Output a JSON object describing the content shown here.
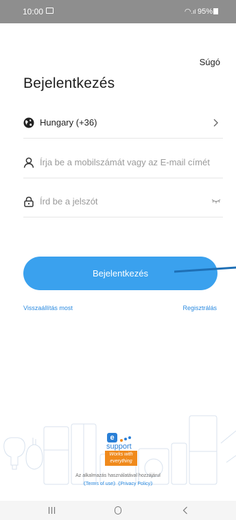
{
  "status_bar": {
    "time": "10:00",
    "battery": "95%",
    "icons": [
      "image-icon",
      "wifi-icon",
      "signal-icon",
      "battery-icon"
    ]
  },
  "header": {
    "help_label": "Súgó"
  },
  "page": {
    "title": "Bejelentkezés"
  },
  "form": {
    "country": {
      "value": "Hungary (+36)",
      "icon": "globe-icon"
    },
    "account": {
      "placeholder": "Írja be a mobilszámát vagy az E-mail címét",
      "icon": "user-icon"
    },
    "password": {
      "placeholder": "Írd be a jelszót",
      "icon": "lock-icon"
    }
  },
  "actions": {
    "login_label": "Bejelentkezés",
    "reset_label": "Visszaállítás most",
    "register_label": "Regisztrálás"
  },
  "brand": {
    "logo_letter": "e",
    "logo_word": "support",
    "badge_text": "Works with everything"
  },
  "consent": {
    "line1": "Az alkalmazás használatával hozzájárul",
    "terms": "《Terms of use》",
    "privacy": "《Privacy Policy》"
  },
  "colors": {
    "accent": "#3aa1ee",
    "link": "#2a8ae0",
    "badge": "#f08a1c",
    "status_bar": "#8e8e8e"
  }
}
